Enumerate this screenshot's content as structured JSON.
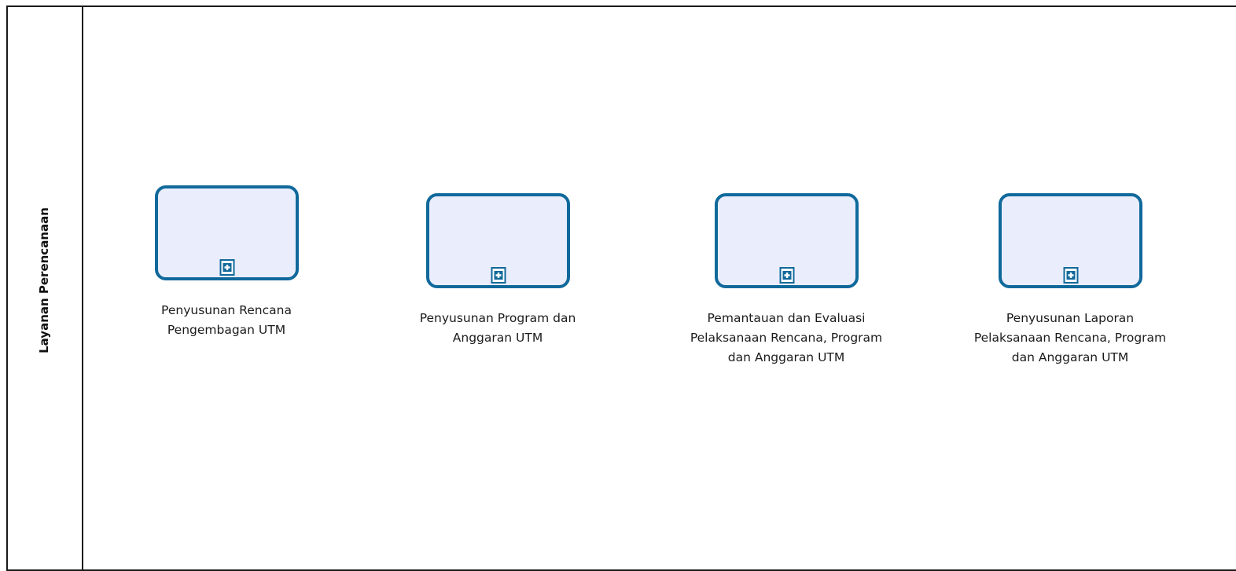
{
  "lane": {
    "label": "Layanan Perencanaan"
  },
  "colors": {
    "task_stroke": "#10699b",
    "task_fill": "#eaedfc",
    "border": "#1a1a1a"
  },
  "tasks": [
    {
      "label": "Penyusunan Rencana\nPengembagan UTM",
      "marker": "subprocess-plus-icon"
    },
    {
      "label": "Penyusunan Program dan\nAnggaran UTM",
      "marker": "subprocess-plus-icon"
    },
    {
      "label": "Pemantauan dan Evaluasi\nPelaksanaan Rencana, Program\ndan Anggaran UTM",
      "marker": "subprocess-plus-icon"
    },
    {
      "label": "Penyusunan Laporan\nPelaksanaan Rencana, Program\ndan Anggaran UTM",
      "marker": "subprocess-plus-icon"
    }
  ]
}
